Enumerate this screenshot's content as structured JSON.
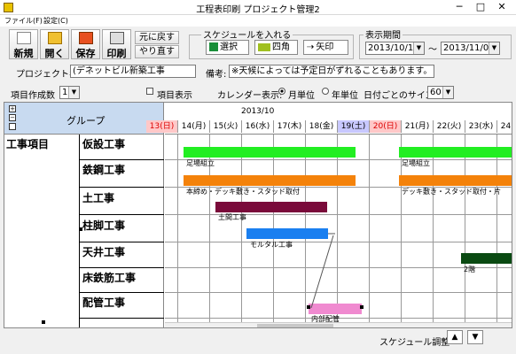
{
  "window": {
    "title": "工程表印刷 プロジェクト管理2",
    "minimize": "─",
    "maximize": "□",
    "close": "✕"
  },
  "menu": {
    "file": "ファイル(F)",
    "settings": "設定(C)"
  },
  "toolbar": {
    "new": "新規",
    "open": "開く",
    "save": "保存",
    "print": "印刷",
    "undo": "元に戻す",
    "redo": "やり直す"
  },
  "schedule_group": {
    "title": "スケジュールを入れる",
    "select": "選択",
    "rect": "四角",
    "arrow": "矢印"
  },
  "period_group": {
    "title": "表示期間",
    "from": "2013/10/13",
    "tilde": "～",
    "to": "2013/11/03"
  },
  "project": {
    "label": "プロジェクト名:",
    "value": "(デネットビル新築工事"
  },
  "remarks": {
    "label": "備考:",
    "value": "※天候によっては予定日がずれることもあります。"
  },
  "options": {
    "count_label": "項目作成数",
    "count_value": "1",
    "item_display": "項目表示",
    "calendar_label": "カレンダー表示:",
    "monthly": "月単位",
    "yearly": "年単位",
    "size_label": "日付ごとのサイズ",
    "size_value": "60"
  },
  "grid": {
    "group_header": "グループ",
    "item_header": "工事項目",
    "month": "2013/10",
    "days": [
      "13(日)",
      "14(月)",
      "15(火)",
      "16(水)",
      "17(木)",
      "18(金)",
      "19(土)",
      "20(日)",
      "21(月)",
      "22(火)",
      "23(水)",
      "24(木)"
    ],
    "groups": [
      "仮設工事",
      "鉄鋼工事",
      "土工事",
      "柱脚工事",
      "天井工事",
      "床鉄筋工事",
      "配管工事"
    ],
    "bar_labels": [
      "足場組立",
      "足場組立",
      "本締め・デッキ敷き・スタッド取付",
      "デッキ敷き・スタッド取付・片",
      "土間工事",
      "モルタル工事",
      "2階",
      "内部配管"
    ]
  },
  "colors": {
    "green": "#22ee22",
    "orange": "#f4820a",
    "maroon": "#7a0a3a",
    "blue": "#1a7ff0",
    "darkgreen": "#0a4a12",
    "pink": "#f08ad0",
    "sat_bg": "#c8c8ff",
    "sun_bg": "#ffc8c8"
  },
  "status": {
    "adjust_label": "スケジュール調整",
    "up": "▲",
    "down": "▼"
  }
}
